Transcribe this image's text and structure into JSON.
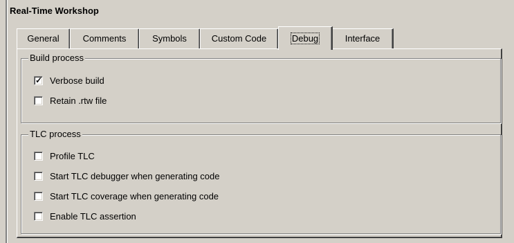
{
  "window": {
    "title": "Real-Time Workshop"
  },
  "tabs": [
    {
      "label": "General",
      "active": false
    },
    {
      "label": "Comments",
      "active": false
    },
    {
      "label": "Symbols",
      "active": false
    },
    {
      "label": "Custom Code",
      "active": false
    },
    {
      "label": "Debug",
      "active": true
    },
    {
      "label": "Interface",
      "active": false
    }
  ],
  "build_process": {
    "title": "Build process",
    "options": [
      {
        "label": "Verbose build",
        "checked": true
      },
      {
        "label": "Retain .rtw file",
        "checked": false
      }
    ]
  },
  "tlc_process": {
    "title": "TLC process",
    "options": [
      {
        "label": "Profile TLC",
        "checked": false
      },
      {
        "label": "Start TLC debugger when generating code",
        "checked": false
      },
      {
        "label": "Start TLC coverage when generating code",
        "checked": false
      },
      {
        "label": "Enable TLC assertion",
        "checked": false
      }
    ]
  },
  "check_glyph": "✓"
}
